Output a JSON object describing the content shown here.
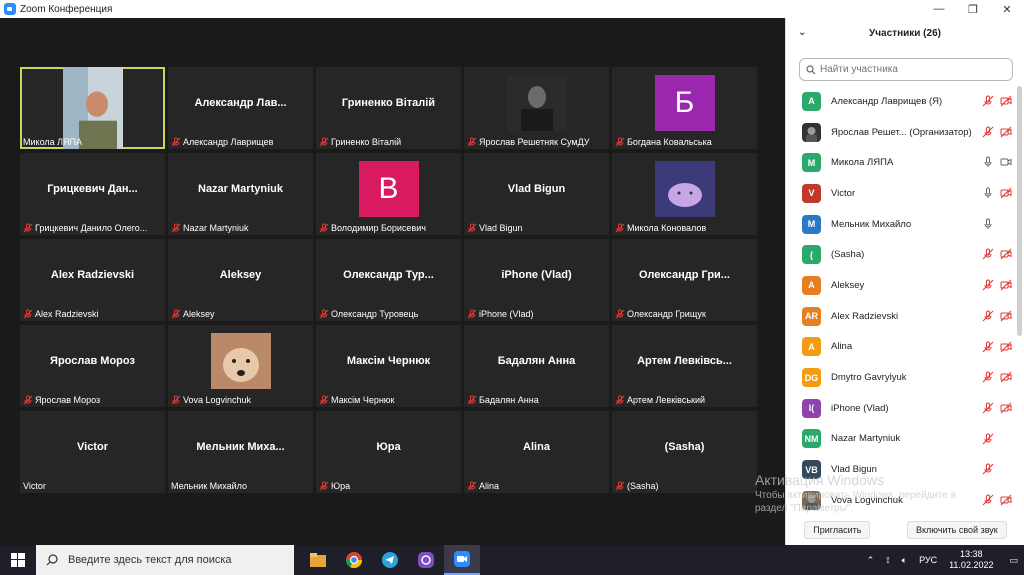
{
  "window": {
    "title": "Zoom Конференция",
    "controls": [
      "—",
      "❐",
      "✕"
    ]
  },
  "tiles": [
    {
      "big": "",
      "caption": "Микола ЛЯПА",
      "muted": false,
      "kind": "photo-man",
      "active": true
    },
    {
      "big": "Александр  Лав...",
      "caption": "Александр Лаврищев",
      "muted": true
    },
    {
      "big": "Гриненко Віталій",
      "caption": "Гриненко Віталій",
      "muted": true
    },
    {
      "big": "",
      "caption": "Ярослав Решетняк СумДУ",
      "muted": true,
      "kind": "photo-dark"
    },
    {
      "big": "",
      "caption": "Богдана Ковальська",
      "muted": true,
      "kind": "letter",
      "letter": "Б",
      "color": "#9b27af"
    },
    {
      "big": "Грицкевич  Дан...",
      "caption": "Грицкевич Данило Олего...",
      "muted": true
    },
    {
      "big": "Nazar Martyniuk",
      "caption": "Nazar Martyniuk",
      "muted": true
    },
    {
      "big": "",
      "caption": "Володимир Борисевич",
      "muted": true,
      "kind": "letter",
      "letter": "В",
      "color": "#d81b60"
    },
    {
      "big": "Vlad Bigun",
      "caption": "Vlad Bigun",
      "muted": true
    },
    {
      "big": "",
      "caption": "Микола Коновалов",
      "muted": true,
      "kind": "photo-cute"
    },
    {
      "big": "Alex Radzievski",
      "caption": "Alex Radzievski",
      "muted": true
    },
    {
      "big": "Aleksey",
      "caption": "Aleksey",
      "muted": true
    },
    {
      "big": "Олександр  Тур...",
      "caption": "Олександр Туровець",
      "muted": true
    },
    {
      "big": "iPhone (Vlad)",
      "caption": "iPhone (Vlad)",
      "muted": true
    },
    {
      "big": "Олександр  Гри...",
      "caption": "Олександр Грищук",
      "muted": true
    },
    {
      "big": "Ярослав Мороз",
      "caption": "Ярослав Мороз",
      "muted": true
    },
    {
      "big": "",
      "caption": "Vova Logvinchuk",
      "muted": true,
      "kind": "photo-dog"
    },
    {
      "big": "Максім Чернюк",
      "caption": "Максім Чернюк",
      "muted": true
    },
    {
      "big": "Бадалян Анна",
      "caption": "Бадалян Анна",
      "muted": true
    },
    {
      "big": "Артем  Левківсь...",
      "caption": "Артем Левківський",
      "muted": true
    },
    {
      "big": "Victor",
      "caption": "Victor",
      "muted": false
    },
    {
      "big": "Мельник  Миха...",
      "caption": "Мельник Михайло",
      "muted": false
    },
    {
      "big": "Юра",
      "caption": "Юра",
      "muted": true
    },
    {
      "big": "Alina",
      "caption": "Alina",
      "muted": true
    },
    {
      "big": "(Sasha)",
      "caption": "(Sasha)",
      "muted": true
    }
  ],
  "panel": {
    "title": "Участники (26)",
    "search_placeholder": "Найти участника",
    "participants": [
      {
        "initials": "A",
        "color": "#2aa96b",
        "name": "Александр Лаврищев (Я)",
        "mic": "off",
        "video": "off"
      },
      {
        "initials": "",
        "color": "#333333",
        "name": "Ярослав Решет... (Организатор)",
        "mic": "off",
        "video": "off",
        "photo": true
      },
      {
        "initials": "M",
        "color": "#2aa96b",
        "name": "Микола ЛЯПА",
        "mic": "on",
        "video": "on"
      },
      {
        "initials": "V",
        "color": "#c0392b",
        "name": "Victor",
        "mic": "on",
        "video": "off"
      },
      {
        "initials": "M",
        "color": "#2979c6",
        "name": "Мельник Михайло",
        "mic": "on",
        "video": "none"
      },
      {
        "initials": "(",
        "color": "#2aa96b",
        "name": " (Sasha)",
        "mic": "off",
        "video": "off"
      },
      {
        "initials": "A",
        "color": "#e67e22",
        "name": "Aleksey",
        "mic": "off",
        "video": "off"
      },
      {
        "initials": "AR",
        "color": "#e67e22",
        "name": "Alex Radzievski",
        "mic": "off",
        "video": "off"
      },
      {
        "initials": "A",
        "color": "#f39c12",
        "name": "Alina",
        "mic": "off",
        "video": "off"
      },
      {
        "initials": "DG",
        "color": "#f39c12",
        "name": "Dmytro Gavrylyuk",
        "mic": "off",
        "video": "off"
      },
      {
        "initials": "I(",
        "color": "#8e44ad",
        "name": "iPhone (Vlad)",
        "mic": "off",
        "video": "off"
      },
      {
        "initials": "NM",
        "color": "#2aa96b",
        "name": "Nazar Martyniuk",
        "mic": "off",
        "video": "none"
      },
      {
        "initials": "VB",
        "color": "#34495e",
        "name": "Vlad Bigun",
        "mic": "off",
        "video": "none"
      },
      {
        "initials": "",
        "color": "#7a6a55",
        "name": "Vova Logvinchuk",
        "mic": "off",
        "video": "off",
        "photo": true
      }
    ],
    "invite_label": "Пригласить",
    "unmute_label": "Включить свой звук"
  },
  "activation": {
    "line1": "Активация Windows",
    "line2": "Чтобы активировать Windows, перейдите в",
    "line3": "раздел \"Параметры\"."
  },
  "taskbar": {
    "search_placeholder": "Введите здесь текст для поиска",
    "lang": "РУС",
    "time": "13:38",
    "date": "11.02.2022"
  }
}
